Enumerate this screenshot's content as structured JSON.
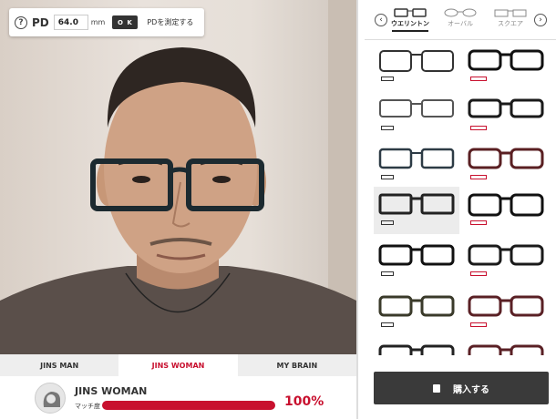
{
  "pd": {
    "help_icon": "?",
    "label": "PD",
    "value": "64.0",
    "unit": "mm",
    "ok_label": "O K",
    "measure_link": "PDを測定する"
  },
  "categories": {
    "tabs": [
      "JINS MAN",
      "JINS WOMAN",
      "MY BRAIN"
    ],
    "active": "JINS WOMAN"
  },
  "match": {
    "name": "JINS WOMAN",
    "label": "マッチ度",
    "percent_text": "100%",
    "percent": 100
  },
  "shapes": {
    "prev_icon": "chevron-left-icon",
    "next_icon": "chevron-right-icon",
    "items": [
      "ウエリントン",
      "オーバル",
      "スクエア"
    ],
    "active": "ウエリントン"
  },
  "buy": {
    "label": "購入する",
    "icon": "shopping-bag-icon"
  },
  "colors": {
    "accent": "#c8102e",
    "dark": "#3a3a3a"
  }
}
